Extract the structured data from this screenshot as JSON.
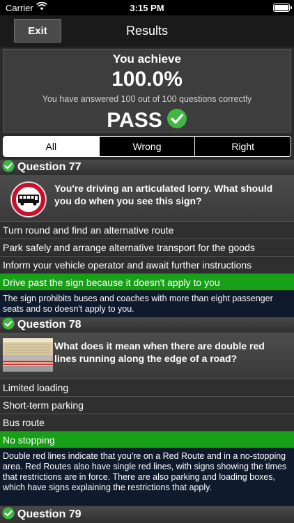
{
  "status": {
    "carrier": "Carrier",
    "time": "3:15 PM"
  },
  "nav": {
    "exit_label": "Exit",
    "title": "Results"
  },
  "summary": {
    "achieve": "You achieve",
    "percent": "100.0%",
    "answered": "You have answered 100 out of 100 questions correctly",
    "pass": "PASS"
  },
  "tabs": [
    "All",
    "Wrong",
    "Right"
  ],
  "colors": {
    "correct_green": "#17a017",
    "explanation_bg": "#0f1a2c"
  },
  "questions": [
    {
      "title": "Question 77",
      "icon": "no-buses-sign-icon",
      "text": "You're driving an articulated lorry. What should you do when you see this sign?",
      "answers": [
        "Turn round and find an alternative route",
        "Park safely and arrange alternative transport for the goods",
        "Inform your vehicle operator and await further instructions",
        "Drive past the sign because it doesn't apply to you"
      ],
      "correct_index": 3,
      "explanation": "The sign prohibits buses and coaches with more than eight passenger seats and so doesn't apply to you."
    },
    {
      "title": "Question 78",
      "icon": "double-red-lines-image-icon",
      "text": "What does it mean when there are double red lines running along the edge of a road?",
      "answers": [
        "Limited loading",
        "Short-term parking",
        "Bus route",
        "No stopping"
      ],
      "correct_index": 3,
      "explanation": "Double red lines indicate that you're on a Red Route and in a no-stopping area. Red Routes also have single red lines, with signs showing the times that restrictions are in force. There are also parking and loading boxes, which have signs explaining the restrictions that apply."
    },
    {
      "title": "Question 79"
    }
  ]
}
